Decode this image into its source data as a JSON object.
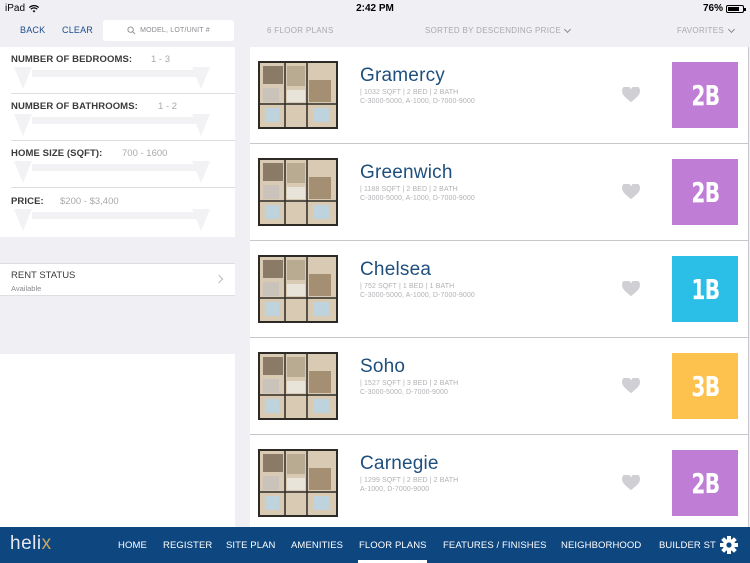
{
  "status_bar": {
    "device": "iPad",
    "time": "2:42 PM",
    "battery_label": "76%",
    "battery_level": 0.76
  },
  "topbar": {
    "back_label": "BACK",
    "clear_label": "CLEAR",
    "search_placeholder": "MODEL, LOT/UNIT #",
    "count_label": "6 FLOOR PLANS",
    "sort_label": "SORTED BY DESCENDING PRICE",
    "favorites_label": "FAVORITES"
  },
  "filters": [
    {
      "label": "NUMBER OF BEDROOMS:",
      "value": "1 - 3"
    },
    {
      "label": "NUMBER OF BATHROOMS:",
      "value": "1 - 2"
    },
    {
      "label": "HOME SIZE (SQFT):",
      "value": "700 - 1600"
    },
    {
      "label": "PRICE:",
      "value": "$200 - $3,400"
    }
  ],
  "rent_status": {
    "label": "RENT STATUS",
    "value": "Available"
  },
  "floor_plans": [
    {
      "name": "Gramercy",
      "details": "| 1032 SQFT | 2 BED | 2 BATH",
      "units": "C-3000-5000, A-1000, D-7000-9000",
      "badge": "2B",
      "badge_color": "#bf7dd6"
    },
    {
      "name": "Greenwich",
      "details": "| 1188 SQFT | 2 BED | 2 BATH",
      "units": "C-3000-5000, A-1000, D-7000-9000",
      "badge": "2B",
      "badge_color": "#bf7dd6"
    },
    {
      "name": "Chelsea",
      "details": "| 752 SQFT | 1 BED | 1 BATH",
      "units": "C-3000-5000, A-1000, D-7000-9000",
      "badge": "1B",
      "badge_color": "#2bbfe8"
    },
    {
      "name": "Soho",
      "details": "| 1527 SQFT | 3 BED | 2 BATH",
      "units": "C-3000-5000, D-7000-9000",
      "badge": "3B",
      "badge_color": "#fdc24e"
    },
    {
      "name": "Carnegie",
      "details": "| 1299 SQFT | 2 BED | 2 BATH",
      "units": "A-1000, D-7000-9000",
      "badge": "2B",
      "badge_color": "#bf7dd6"
    }
  ],
  "nav": {
    "logo_main": "heli",
    "logo_accent": "x",
    "items": [
      "HOME",
      "REGISTER",
      "SITE PLAN",
      "AMENITIES",
      "FLOOR PLANS",
      "FEATURES / FINISHES",
      "NEIGHBORHOOD",
      "BUILDER ST"
    ],
    "active": "FLOOR PLANS"
  },
  "colors": {
    "brand_blue": "#0e4680",
    "title_blue": "#1f4f7d",
    "logo_gold": "#c9a85a"
  }
}
